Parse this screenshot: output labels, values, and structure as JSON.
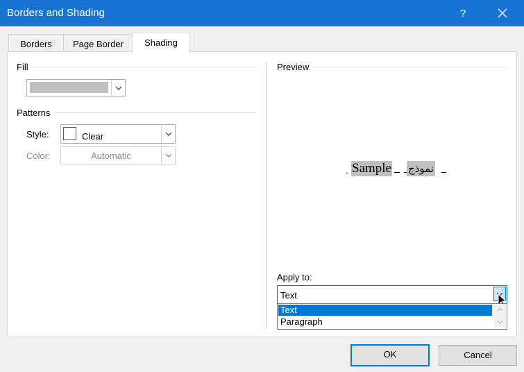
{
  "window": {
    "title": "Borders and Shading",
    "help_label": "?"
  },
  "tabs": [
    {
      "label": "Borders"
    },
    {
      "label": "Page Border"
    },
    {
      "label": "Shading"
    }
  ],
  "fill": {
    "label": "Fill",
    "color": "#c0c0c0"
  },
  "patterns": {
    "label": "Patterns",
    "style_label": "Style:",
    "style_value": "Clear",
    "color_label": "Color:",
    "color_value": "Automatic"
  },
  "preview": {
    "label": "Preview",
    "sample_text": "Sample",
    "arabic_text": "نموذج",
    "shading_color": "#c0c0c0"
  },
  "apply_to": {
    "label": "Apply to:",
    "value": "Text",
    "options": [
      "Text",
      "Paragraph"
    ],
    "selected_index": 0
  },
  "buttons": {
    "ok": "OK",
    "cancel": "Cancel"
  },
  "colors": {
    "titlebar": "#1874d2",
    "accent": "#0078d7",
    "dialog_bg": "#f0f0f0"
  }
}
